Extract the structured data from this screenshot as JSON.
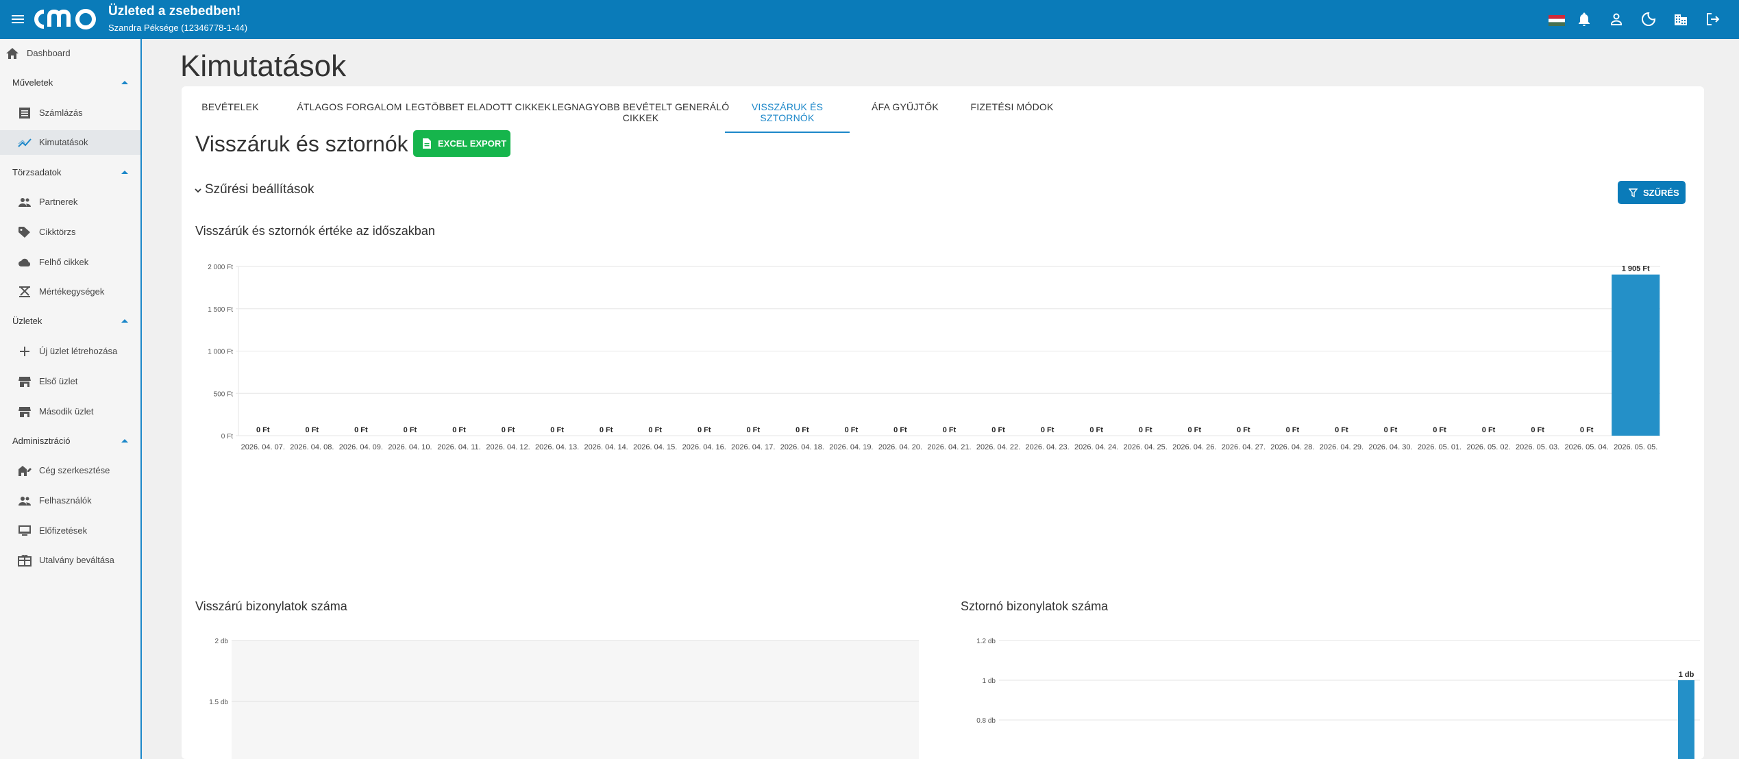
{
  "header": {
    "shop_name": "Üzleted a zsebedben!",
    "company": "Szandra Péksége (12346778-1-44)",
    "icons": [
      "menu-icon",
      "hungarian-flag-icon",
      "bell-icon",
      "user-icon",
      "dark-mode-icon",
      "building-icon",
      "logout-icon"
    ]
  },
  "sidebar": {
    "dashboard": "Dashboard",
    "groups": [
      {
        "label": "Műveletek",
        "items": [
          "Számlázás",
          "Kimutatások"
        ]
      },
      {
        "label": "Törzsadatok",
        "items": [
          "Partnerek",
          "Cikktörzs",
          "Felhő cikkek",
          "Mértékegységek"
        ]
      },
      {
        "label": "Üzletek",
        "items": [
          "Új üzlet létrehozása",
          "Első üzlet",
          "Második üzlet"
        ]
      },
      {
        "label": "Adminisztráció",
        "items": [
          "Cég szerkesztése",
          "Felhasználók",
          "Előfizetések",
          "Utalvány beváltása"
        ]
      }
    ],
    "active": "Kimutatások"
  },
  "page": {
    "title": "Kimutatások",
    "tabs": [
      "BEVÉTELEK",
      "ÁTLAGOS FORGALOM",
      "LEGTÖBBET ELADOTT CIKKEK",
      "LEGNAGYOBB BEVÉTELT GENERÁLÓ CIKKEK",
      "VISSZÁRUK ÉS SZTORNÓK",
      "ÁFA GYŰJTŐK",
      "FIZETÉSI MÓDOK"
    ],
    "active_tab": "VISSZÁRUK ÉS SZTORNÓK",
    "section_title": "Visszáruk és sztornók",
    "excel_button": "EXCEL EXPORT",
    "filter_toggle": "Szűrési beállítások",
    "filter_button": "SZŰRÉS"
  },
  "colors": {
    "primary": "#0a7bb9",
    "accent": "#1c87c9",
    "excel": "#16b54c",
    "bar": "#2490c8"
  },
  "chart_data": [
    {
      "type": "bar",
      "title": "Visszárúk és sztornók értéke az időszakban",
      "categories": [
        "2026. 04. 07.",
        "2026. 04. 08.",
        "2026. 04. 09.",
        "2026. 04. 10.",
        "2026. 04. 11.",
        "2026. 04. 12.",
        "2026. 04. 13.",
        "2026. 04. 14.",
        "2026. 04. 15.",
        "2026. 04. 16.",
        "2026. 04. 17.",
        "2026. 04. 18.",
        "2026. 04. 19.",
        "2026. 04. 20.",
        "2026. 04. 21.",
        "2026. 04. 22.",
        "2026. 04. 23.",
        "2026. 04. 24.",
        "2026. 04. 25.",
        "2026. 04. 26.",
        "2026. 04. 27.",
        "2026. 04. 28.",
        "2026. 04. 29.",
        "2026. 04. 30.",
        "2026. 05. 01.",
        "2026. 05. 02.",
        "2026. 05. 03.",
        "2026. 05. 04.",
        "2026. 05. 05."
      ],
      "values": [
        0,
        0,
        0,
        0,
        0,
        0,
        0,
        0,
        0,
        0,
        0,
        0,
        0,
        0,
        0,
        0,
        0,
        0,
        0,
        0,
        0,
        0,
        0,
        0,
        0,
        0,
        0,
        0,
        1905
      ],
      "data_labels": [
        "0 Ft",
        "0 Ft",
        "0 Ft",
        "0 Ft",
        "0 Ft",
        "0 Ft",
        "0 Ft",
        "0 Ft",
        "0 Ft",
        "0 Ft",
        "0 Ft",
        "0 Ft",
        "0 Ft",
        "0 Ft",
        "0 Ft",
        "0 Ft",
        "0 Ft",
        "0 Ft",
        "0 Ft",
        "0 Ft",
        "0 Ft",
        "0 Ft",
        "0 Ft",
        "0 Ft",
        "0 Ft",
        "0 Ft",
        "0 Ft",
        "0 Ft",
        "1 905 Ft"
      ],
      "yticks": [
        0,
        500,
        1000,
        1500,
        2000
      ],
      "ytick_labels": [
        "0 Ft",
        "500 Ft",
        "1 000 Ft",
        "1 500 Ft",
        "2 000 Ft"
      ],
      "ylim": [
        0,
        2000
      ],
      "grid": true
    },
    {
      "type": "bar",
      "title": "Visszárú bizonylatok száma",
      "categories": [],
      "values": [],
      "yticks": [
        1.5,
        2
      ],
      "ytick_labels": [
        "1.5 db",
        "2 db"
      ],
      "grid": true
    },
    {
      "type": "bar",
      "title": "Sztornó bizonylatok száma",
      "categories": [],
      "values": [
        1
      ],
      "data_labels": [
        "1 db"
      ],
      "yticks": [
        0.8,
        1,
        1.2
      ],
      "ytick_labels": [
        "0.8 db",
        "1 db",
        "1.2 db"
      ],
      "grid": true
    }
  ]
}
